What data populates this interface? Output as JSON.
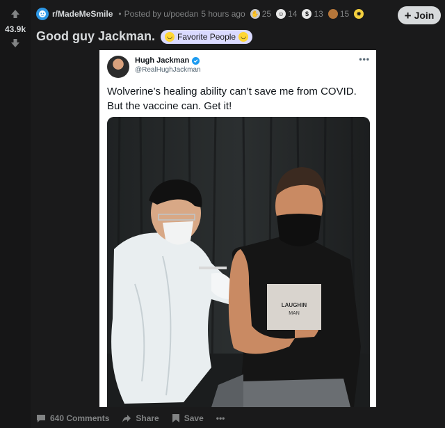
{
  "vote": {
    "score": "43.9k"
  },
  "meta": {
    "subreddit": "r/MadeMeSmile",
    "separator": "•",
    "posted_by": "Posted by u/poedan",
    "time": "5 hours ago",
    "awards": [
      {
        "icon": "hands-award-icon",
        "count": "25",
        "color": "#c9c9c9"
      },
      {
        "icon": "smile-award-icon",
        "count": "14",
        "color": "#e8e8e8"
      },
      {
        "icon": "silver-award-icon",
        "count": "13",
        "color": "#e8e8e8"
      },
      {
        "icon": "poop-award-icon",
        "count": "15",
        "color": "#b5763a"
      },
      {
        "icon": "sun-award-icon",
        "color": "#f4d03f"
      }
    ]
  },
  "join": {
    "label": "Join"
  },
  "post": {
    "title": "Good guy Jackman.",
    "flair": "Favorite People"
  },
  "tweet": {
    "name": "Hugh Jackman",
    "handle": "@RealHughJackman",
    "text_line1": "Wolverine’s healing ability can’t save me from COVID.",
    "text_line2": "But the vaccine can.  Get it!",
    "shirt_line1": "LAUGHIN",
    "shirt_line2": "MAN"
  },
  "actions": {
    "comments": "640 Comments",
    "share": "Share",
    "save": "Save",
    "more": "•••"
  },
  "colors": {
    "background": "#1a1a1b",
    "text": "#d7dadc",
    "muted": "#818384",
    "flair": "#dadaff",
    "twitter_blue": "#1d9bf0"
  }
}
